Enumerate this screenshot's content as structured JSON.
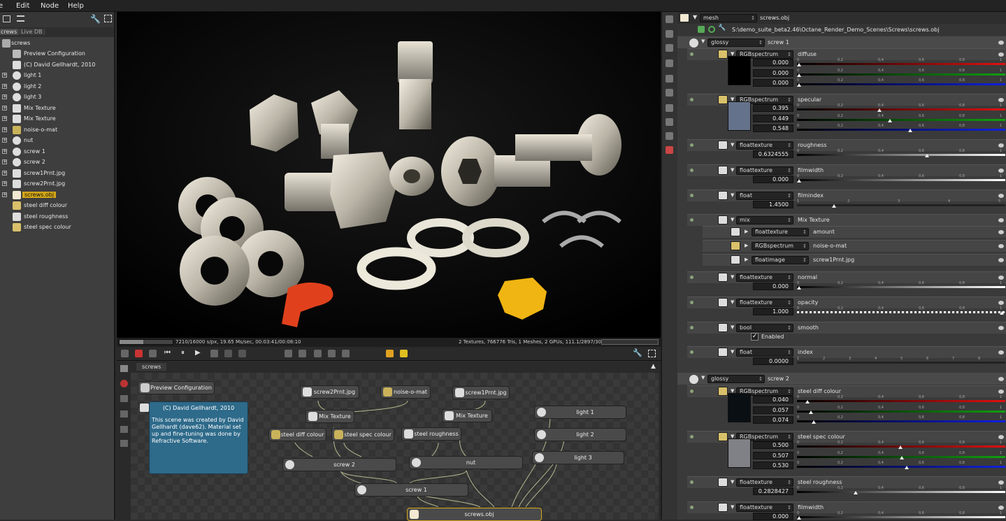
{
  "menu": {
    "items": [
      "e",
      "Edit",
      "Node",
      "Help"
    ]
  },
  "left": {
    "tabs": [
      "crews",
      "Live DB"
    ],
    "root": "screws",
    "items": [
      {
        "label": "Preview Configuration",
        "icon": "config-icon"
      },
      {
        "label": "(C) David Gellhardt, 2010",
        "icon": "comment-icon"
      },
      {
        "label": "light 1",
        "icon": "sphere-icon"
      },
      {
        "label": "light 2",
        "icon": "sphere-icon"
      },
      {
        "label": "light 3",
        "icon": "sphere-icon"
      },
      {
        "label": "Mix Texture",
        "icon": "texture-icon"
      },
      {
        "label": "Mix Texture",
        "icon": "texture-icon"
      },
      {
        "label": "noise-o-mat",
        "icon": "noise-icon"
      },
      {
        "label": "nut",
        "icon": "sphere-icon"
      },
      {
        "label": "screw 1",
        "icon": "sphere-icon"
      },
      {
        "label": "screw 2",
        "icon": "sphere-icon"
      },
      {
        "label": "screw1Prnt.jpg",
        "icon": "image-icon"
      },
      {
        "label": "screw2Prnt.jpg",
        "icon": "image-icon"
      },
      {
        "label": "screws.obj",
        "icon": "mesh-icon"
      },
      {
        "label": "steel diff colour",
        "icon": "color-icon"
      },
      {
        "label": "steel roughness",
        "icon": "float-icon"
      },
      {
        "label": "steel spec colour",
        "icon": "color-icon"
      }
    ]
  },
  "viewport": {
    "progress": "7210/16000 s/px, 19.65 Ms/sec, 00:03:41/00:08:10",
    "stats": "2 Textures, 766776 Tris, 1 Meshes, 2 GPUs, 111.1/2897/3071 MB",
    "progress_fraction": 0.45
  },
  "graph": {
    "tab": "screws",
    "comment_title": "(C) David Gellhardt, 2010",
    "comment_body": "This scene was created by David Gellhardt (dave62). Material set up and fine-tuning was done by Refractive Software.",
    "nodes": {
      "preview": "Preview Configuration",
      "screw2prnt": "screw2Prnt.jpg",
      "noise": "noise-o-mat",
      "screw1prnt": "screw1Prnt.jpg",
      "mix1": "Mix Texture",
      "mix2": "Mix Texture",
      "light1": "light 1",
      "light2": "light 2",
      "light3": "light 3",
      "diff": "steel diff colour",
      "spec": "steel spec colour",
      "rough": "steel roughness",
      "screw2": "screw 2",
      "nut": "nut",
      "screw1": "screw 1",
      "obj": "screws.obj"
    }
  },
  "right": {
    "type": "mesh",
    "name": "screws.obj",
    "path": "S:\\demo_suite_beta2.46\\Octane_Render_Demo_Scenes\\Screws\\screws.obj",
    "mat1": {
      "type": "glossy",
      "name": "screw 1",
      "diffuse": {
        "type": "RGBspectrum",
        "label": "diffuse",
        "r": "0.000",
        "g": "0.000",
        "b": "0.000"
      },
      "specular": {
        "type": "RGBspectrum",
        "label": "specular",
        "r": "0.395",
        "g": "0.449",
        "b": "0.548"
      },
      "roughness": {
        "type": "floattexture",
        "label": "roughness",
        "value": "0.6324555"
      },
      "filmwidth": {
        "type": "floattexture",
        "label": "filmwidth",
        "value": "0.000"
      },
      "filmindex": {
        "type": "float",
        "label": "filmindex",
        "value": "1.4500"
      },
      "mix": {
        "type": "mix",
        "label": "Mix Texture",
        "amount": {
          "type": "floattexture",
          "label": "amount"
        },
        "tex1": {
          "type": "RGBspectrum",
          "label": "noise-o-mat"
        },
        "tex2": {
          "type": "floatimage",
          "label": "screw1Prnt.jpg"
        }
      },
      "normal": {
        "type": "floattexture",
        "label": "normal",
        "value": "0.000"
      },
      "opacity": {
        "type": "floattexture",
        "label": "opacity",
        "value": "1.000"
      },
      "smooth": {
        "type": "bool",
        "label": "smooth",
        "value": "Enabled"
      },
      "index": {
        "type": "float",
        "label": "index",
        "value": "0.0000"
      }
    },
    "mat2": {
      "type": "glossy",
      "name": "screw 2",
      "diffuse": {
        "type": "RGBspectrum",
        "label": "steel diff colour",
        "r": "0.040",
        "g": "0.057",
        "b": "0.074"
      },
      "specular": {
        "type": "RGBspectrum",
        "label": "steel spec colour",
        "r": "0.500",
        "g": "0.507",
        "b": "0.530"
      },
      "roughness": {
        "type": "floattexture",
        "label": "steel roughness",
        "value": "0.2828427"
      },
      "filmwidth": {
        "type": "floattexture",
        "label": "filmwidth",
        "value": "0.000"
      }
    },
    "ticks": [
      "0",
      "0,2",
      "0,4",
      "0,6",
      "0,8",
      "1"
    ],
    "ticks_index": [
      "1",
      "2",
      "3",
      "4",
      "5",
      "6",
      "7",
      "8"
    ],
    "ticks_film": [
      "1",
      "2",
      "3",
      "4",
      "5"
    ]
  }
}
